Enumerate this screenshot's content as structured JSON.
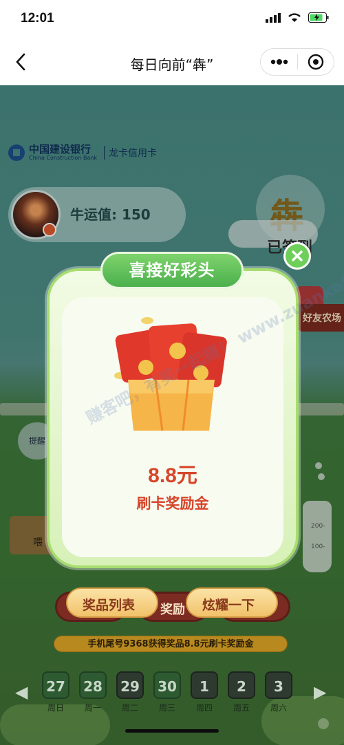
{
  "status_bar": {
    "time": "12:01"
  },
  "nav": {
    "title": "每日向前“犇”"
  },
  "brand": {
    "name": "中国建设银行",
    "name_en": "China Construction Bank",
    "sub": "龙卡信用卡"
  },
  "profile": {
    "luck_label": "牛运值: 150"
  },
  "checkin": {
    "char": "犇",
    "status": "已签到"
  },
  "side": {
    "friend_farm": "好友农场",
    "feed": "喂",
    "tip": "提醒"
  },
  "milk": {
    "m200": "200-",
    "m100": "100-"
  },
  "buttons": {
    "prize_list": "奖品列表",
    "reward": "奖励",
    "show_off": "炫耀一下"
  },
  "marquee": "手机尾号9368获得奖品8.8元刷卡奖励金",
  "days": [
    {
      "num": "27",
      "label": "周日",
      "done": true
    },
    {
      "num": "28",
      "label": "周一",
      "done": true
    },
    {
      "num": "29",
      "label": "周二",
      "done": false
    },
    {
      "num": "30",
      "label": "周三",
      "done": true
    },
    {
      "num": "1",
      "label": "周四",
      "done": false
    },
    {
      "num": "2",
      "label": "周五",
      "done": false
    },
    {
      "num": "3",
      "label": "周六",
      "done": false
    }
  ],
  "modal": {
    "title": "喜接好彩头",
    "amount": "8.8元",
    "reward_name": "刷卡奖励金"
  },
  "watermark": "赚客吧，有奖一起赚！ www.zuanke8.com",
  "colors": {
    "modal_green": "#6fcf5b",
    "amount_red": "#d7452a",
    "button_dark": "#7b2b22"
  }
}
